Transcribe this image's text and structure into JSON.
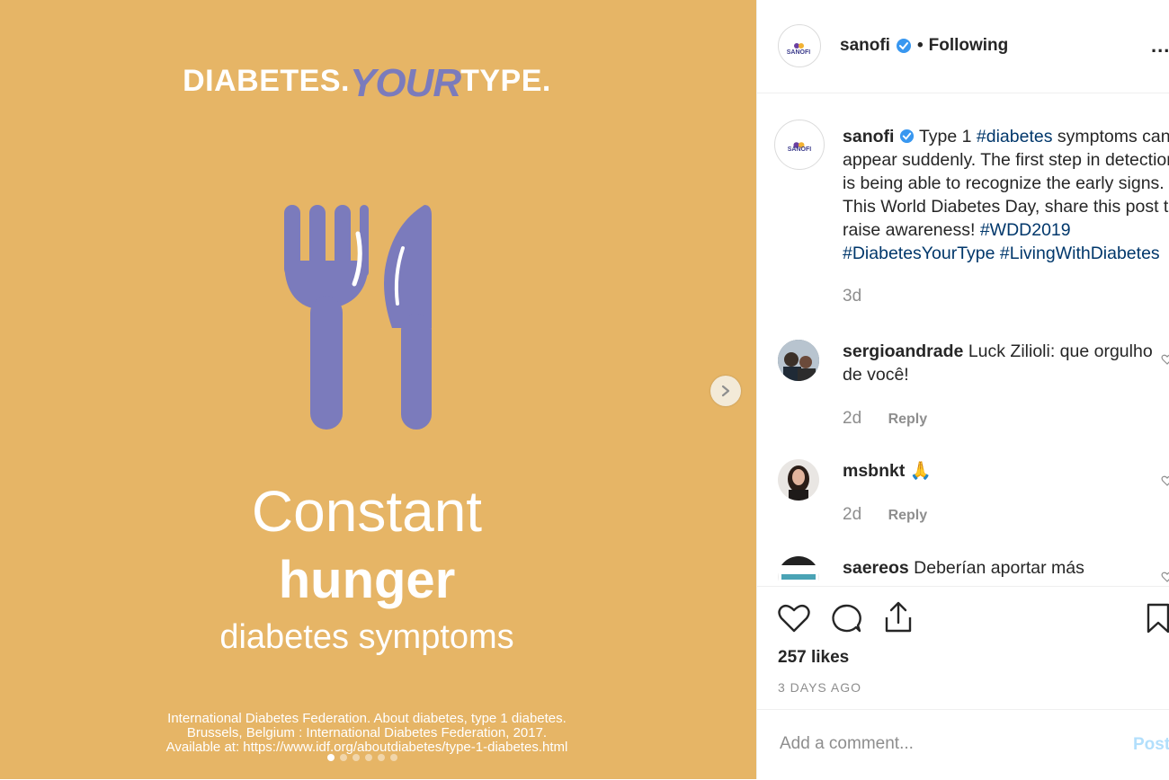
{
  "media": {
    "brand_left": "DIABETES.",
    "brand_your": "YOUR",
    "brand_right": "TYPE.",
    "headline_line1": "Constant",
    "headline_line2": "hunger",
    "headline_line3": "diabetes symptoms",
    "citation_line1": "International Diabetes Federation. About diabetes, type 1 diabetes.",
    "citation_line2": "Brussels, Belgium : International Diabetes Federation, 2017.",
    "citation_line3": "Available at: https://www.idf.org/aboutdiabetes/type-1-diabetes.html",
    "background_color": "#e6b566",
    "accent_color": "#7b7bbc",
    "slide_count": 6,
    "active_slide": 1
  },
  "header": {
    "avatar_label": "SANOFI",
    "username": "sanofi",
    "separator": "•",
    "follow_status": "Following",
    "more": "..."
  },
  "caption": {
    "username": "sanofi",
    "text_before": "Type 1 ",
    "tag1": "#diabetes",
    "text_after": " symptoms can appear suddenly. The first step in detection is being able to recognize the early signs. This World Diabetes Day, share this post to raise awareness!",
    "tag2": "#WDD2019",
    "tag3": "#DiabetesYourType",
    "tag4": "#LivingWithDiabetes",
    "timestamp": "3d"
  },
  "comments": [
    {
      "username": "sergioandrade",
      "text": "Luck Zilioli: que orgulho de você!",
      "timestamp": "2d",
      "reply": "Reply"
    },
    {
      "username": "msbnkt",
      "text": "🙏",
      "timestamp": "2d",
      "reply": "Reply"
    },
    {
      "username": "saereos",
      "text": "Deberían aportar más"
    }
  ],
  "actions": {
    "likes": "257 likes",
    "posted": "3 DAYS AGO"
  },
  "add_comment": {
    "placeholder": "Add a comment...",
    "post_label": "Post"
  },
  "colors": {
    "verified": "#3897f0",
    "hashtag": "#00376b",
    "post_button": "#b2dffc"
  }
}
